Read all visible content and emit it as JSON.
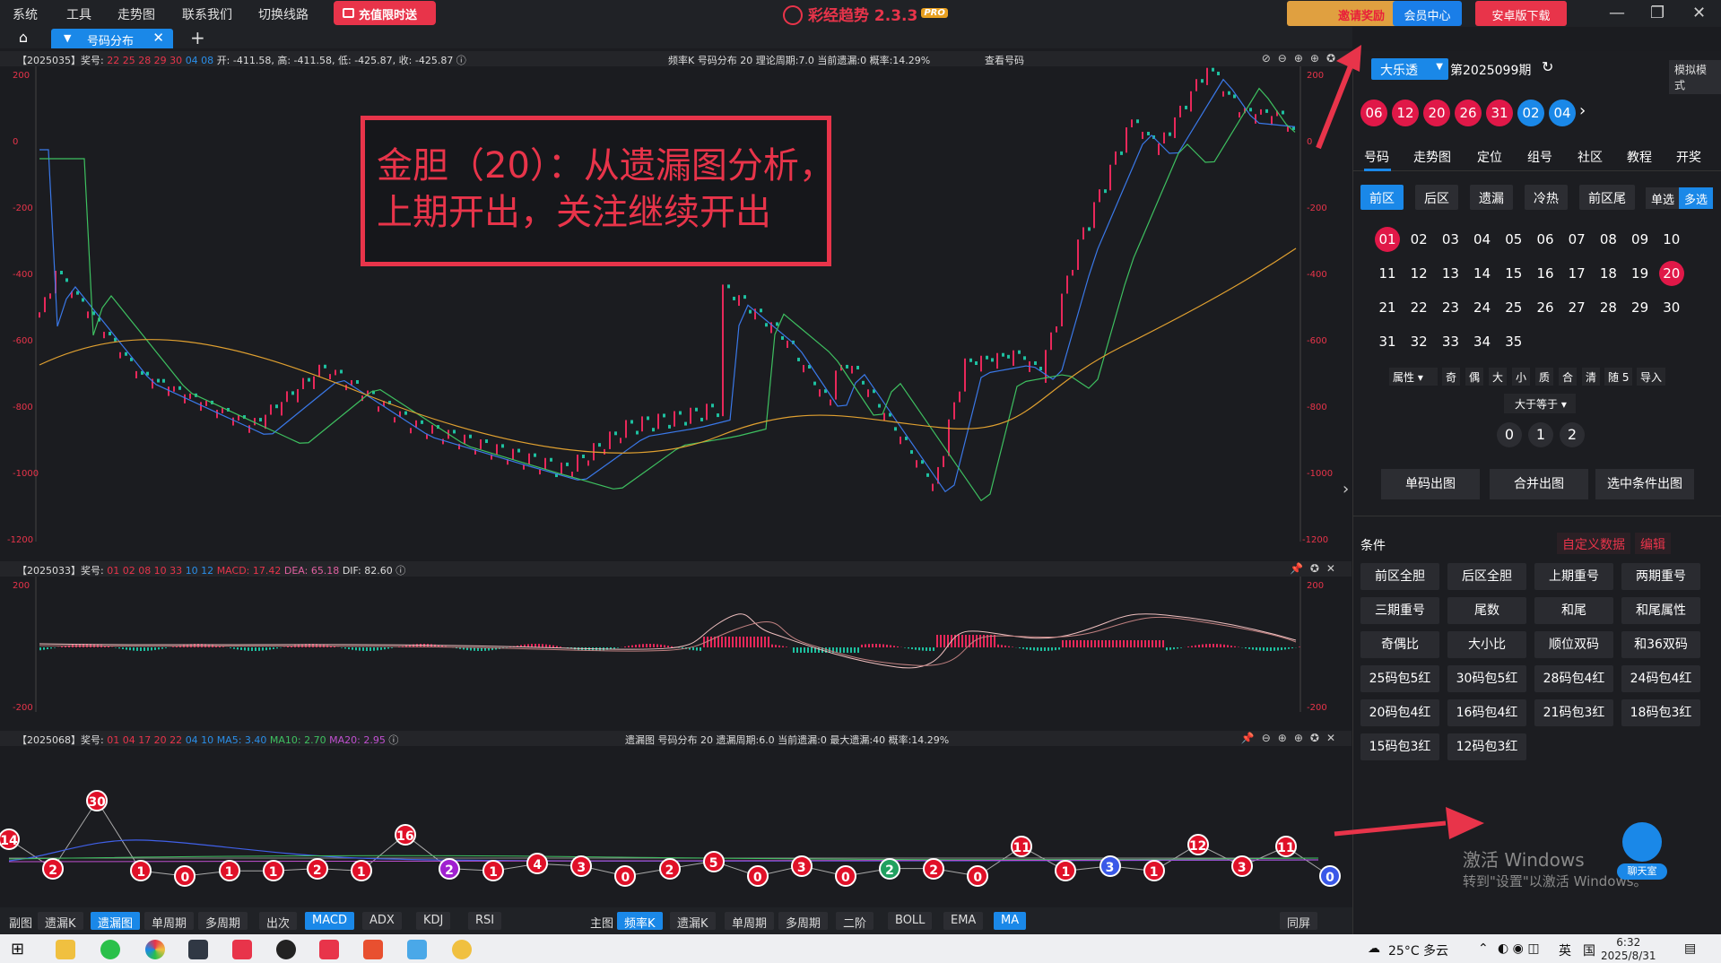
{
  "menu": {
    "items": [
      "系统",
      "工具",
      "走势图",
      "联系我们",
      "切换线路"
    ],
    "recharge": "充值限时送"
  },
  "app": {
    "title": "彩经趋势 2.3.3",
    "badge": "PRO"
  },
  "top_buttons": {
    "invite": "邀请奖励",
    "member": "会员中心",
    "android": "安卓版下载"
  },
  "tabs": {
    "active": "号码分布",
    "add": "+"
  },
  "pane1": {
    "issue": "【2025035】奖号:",
    "nums_red": "22 25 28 29 30",
    "nums_blue": "04 08",
    "ohlc": "开: -411.58, 高: -411.58, 低: -425.87, 收: -425.87",
    "mid": "频率K   号码分布   20     理论周期:7.0   当前遗漏:0   概率:14.29%",
    "link": "查看号码",
    "y_labels": [
      "200",
      "0",
      "-200",
      "-400",
      "-600",
      "-800",
      "-1000",
      "-1200"
    ]
  },
  "annotation": {
    "line1": "金胆（20）：从遗漏图分析，",
    "line2": "上期开出，关注继续开出"
  },
  "pane2": {
    "issue": "【2025033】奖号:",
    "nums_red": "01 02 08 10 33",
    "nums_blue": "10 12",
    "macd_label": "MACD: 17.42",
    "dea_label": "DEA: 65.18",
    "dif_label": "DIF: 82.60",
    "y_labels": [
      "200",
      "-200"
    ]
  },
  "pane3": {
    "issue": "【2025068】奖号:",
    "nums_red": "01 04 17 20 22",
    "nums_blue": "04 10",
    "ma5": "MA5: 3.40",
    "ma10": "MA10: 2.70",
    "ma20": "MA20: 2.95",
    "mid": "遗漏图   号码分布   20     遗漏周期:6.0   当前遗漏:0   最大遗漏:40   概率:14.29%",
    "balls": [
      "14",
      "2",
      "30",
      "1",
      "0",
      "1",
      "1",
      "2",
      "1",
      "16",
      "2",
      "1",
      "4",
      "3",
      "0",
      "2",
      "5",
      "0",
      "3",
      "0",
      "2",
      "2",
      "0",
      "11",
      "1",
      "3",
      "1",
      "12",
      "3",
      "11",
      "0"
    ]
  },
  "bottombar": {
    "sub_label": "副图",
    "sub_items": [
      "遗漏K",
      "遗漏图",
      "单周期",
      "多周期",
      "出次",
      "MACD",
      "ADX",
      "KDJ",
      "RSI"
    ],
    "main_label": "主图",
    "main_items": [
      "频率K",
      "遗漏K",
      "单周期",
      "多周期",
      "二阶",
      "BOLL",
      "EMA",
      "MA"
    ],
    "sync": "同屏"
  },
  "right": {
    "lottery": "大乐透",
    "issue": "第2025099期",
    "mock": "模拟模式",
    "draw_red": [
      "06",
      "12",
      "20",
      "26",
      "31"
    ],
    "draw_blue": [
      "02",
      "04"
    ],
    "tabs": [
      "号码",
      "走势图",
      "定位",
      "组号",
      "社区",
      "教程",
      "开奖"
    ],
    "subtabs": [
      "前区",
      "后区",
      "遗漏",
      "冷热",
      "前区尾"
    ],
    "single": "单选",
    "multi": "多选",
    "numbers": [
      "01",
      "02",
      "03",
      "04",
      "05",
      "06",
      "07",
      "08",
      "09",
      "10",
      "11",
      "12",
      "13",
      "14",
      "15",
      "16",
      "17",
      "18",
      "19",
      "20",
      "21",
      "22",
      "23",
      "24",
      "25",
      "26",
      "27",
      "28",
      "29",
      "30",
      "31",
      "32",
      "33",
      "34",
      "35"
    ],
    "attr_label": "属性",
    "attr_items": [
      "奇",
      "偶",
      "大",
      "小",
      "质",
      "合",
      "清",
      "随"
    ],
    "random_count": "5",
    "import": "导入",
    "gte": "大于等于",
    "counts": [
      "0",
      "1",
      "2"
    ],
    "actions": [
      "单码出图",
      "合并出图",
      "选中条件出图"
    ],
    "cond_title": "条件",
    "custom_data": "自定义数据",
    "edit": "编辑",
    "conditions": [
      "前区全胆",
      "后区全胆",
      "上期重号",
      "两期重号",
      "三期重号",
      "尾数",
      "和尾",
      "和尾属性",
      "奇偶比",
      "大小比",
      "顺位双码",
      "和36双码",
      "25码包5红",
      "30码包5红",
      "28码包4红",
      "24码包4红",
      "20码包4红",
      "16码包4红",
      "21码包3红",
      "18码包3红",
      "15码包3红",
      "12码包3红"
    ],
    "watermark": "激活 Windows",
    "watermark2": "转到\"设置\"以激活 Windows。",
    "chat": "聊天室"
  },
  "taskbar": {
    "weather": "25°C 多云",
    "ime": "英",
    "time": "6:32",
    "date": "2025/8/31"
  }
}
